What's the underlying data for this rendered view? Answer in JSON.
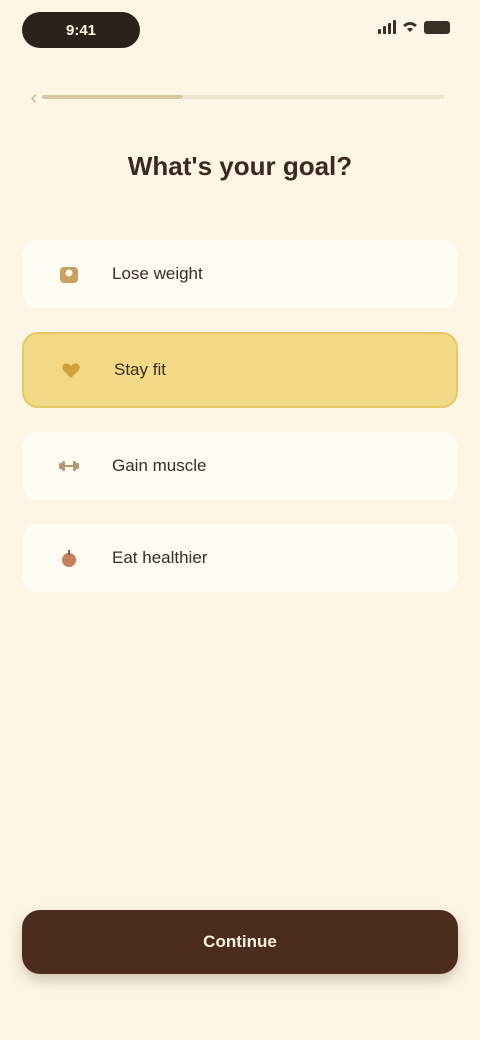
{
  "status_bar": {
    "time": "9:41"
  },
  "header": {
    "progress": 0.35
  },
  "question": {
    "title": "What's your goal?"
  },
  "options": [
    {
      "label": "Lose weight",
      "icon": "scale-icon",
      "selected": false,
      "color": "#c8a060"
    },
    {
      "label": "Stay fit",
      "icon": "heart-icon",
      "selected": true,
      "color": "#d2a13a"
    },
    {
      "label": "Gain muscle",
      "icon": "dumbbell-icon",
      "selected": false,
      "color": "#b69877"
    },
    {
      "label": "Eat healthier",
      "icon": "apple-icon",
      "selected": false,
      "color": "#c98058"
    }
  ],
  "footer": {
    "continue_label": "Continue"
  },
  "colors": {
    "background": "#fdf6e4",
    "selected_fill": "#f1d985",
    "primary": "#4c2c1f"
  }
}
